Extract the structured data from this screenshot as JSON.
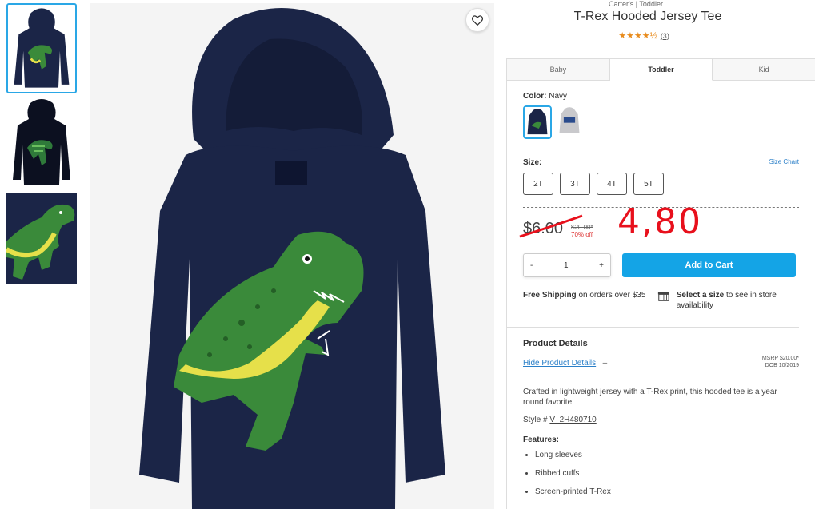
{
  "product": {
    "breadcrumb": "Carter's | Toddler",
    "title": "T-Rex Hooded Jersey Tee",
    "stars": "★★★★½",
    "review_count": "(3)"
  },
  "tabs": [
    {
      "label": "Baby"
    },
    {
      "label": "Toddler"
    },
    {
      "label": "Kid"
    }
  ],
  "color": {
    "label": "Color:",
    "value": "Navy"
  },
  "size": {
    "label": "Size:",
    "chart_link": "Size Chart",
    "options": [
      "2T",
      "3T",
      "4T",
      "5T"
    ]
  },
  "price": {
    "current": "$6.00",
    "original": "$20.00*",
    "discount": "70% off",
    "handwritten_note": "4,80"
  },
  "cart": {
    "minus": "-",
    "quantity": "1",
    "plus": "+",
    "add_label": "Add to Cart"
  },
  "shipping": {
    "free_bold": "Free Shipping",
    "free_rest": " on orders over $35",
    "store_bold": "Select a size",
    "store_rest": " to see in store availability"
  },
  "details": {
    "heading": "Product Details",
    "hide_link": "Hide Product Details",
    "hide_arrow": "–",
    "msrp": "MSRP $20.00*",
    "dob": "DOB 10/2019",
    "description": "Crafted in lightweight jersey with a T-Rex print, this hooded tee is a year round favorite.",
    "style_label": "Style #",
    "style_value": "V_2H480710",
    "features_heading": "Features:",
    "features": [
      "Long sleeves",
      "Ribbed cuffs",
      "Screen-printed T-Rex"
    ]
  },
  "colors": {
    "navy": "#1b2547",
    "dino_green": "#3a8a3a",
    "accent_blue": "#14a4e6",
    "star_orange": "#e88b1c",
    "note_red": "#e8101c"
  }
}
